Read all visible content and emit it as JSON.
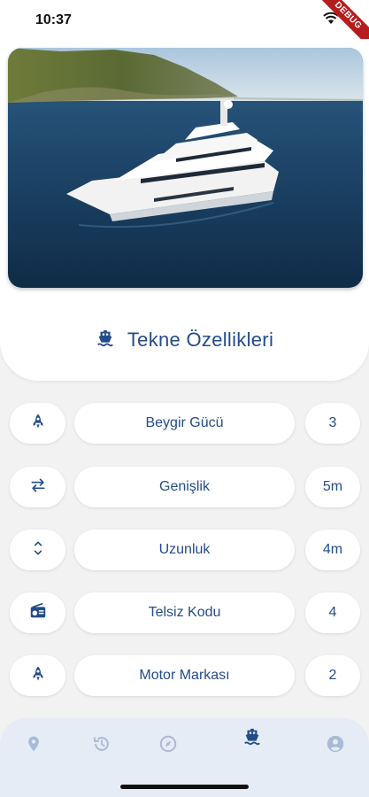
{
  "status": {
    "time": "10:37",
    "debug_label": "DEBUG"
  },
  "header": {
    "title": "Tekne Özellikleri",
    "title_icon": "ship-icon"
  },
  "colors": {
    "primary": "#244c8a",
    "nav_background": "#e6ecf5",
    "inactive_icon": "#a9bbd6"
  },
  "features": [
    {
      "icon": "rocket-icon",
      "label": "Beygir Gücü",
      "value": "3"
    },
    {
      "icon": "swap-horizontal-icon",
      "label": "Genişlik",
      "value": "5m"
    },
    {
      "icon": "unfold-vertical-icon",
      "label": "Uzunluk",
      "value": "4m"
    },
    {
      "icon": "radio-icon",
      "label": "Telsiz Kodu",
      "value": "4"
    },
    {
      "icon": "rocket-icon",
      "label": "Motor Markası",
      "value": "2"
    }
  ],
  "bottom_nav": [
    {
      "icon": "location-pin-icon",
      "active": false
    },
    {
      "icon": "history-icon",
      "active": false
    },
    {
      "icon": "compass-icon",
      "active": false
    },
    {
      "icon": "ship-icon",
      "active": true
    },
    {
      "icon": "account-icon",
      "active": false
    }
  ]
}
